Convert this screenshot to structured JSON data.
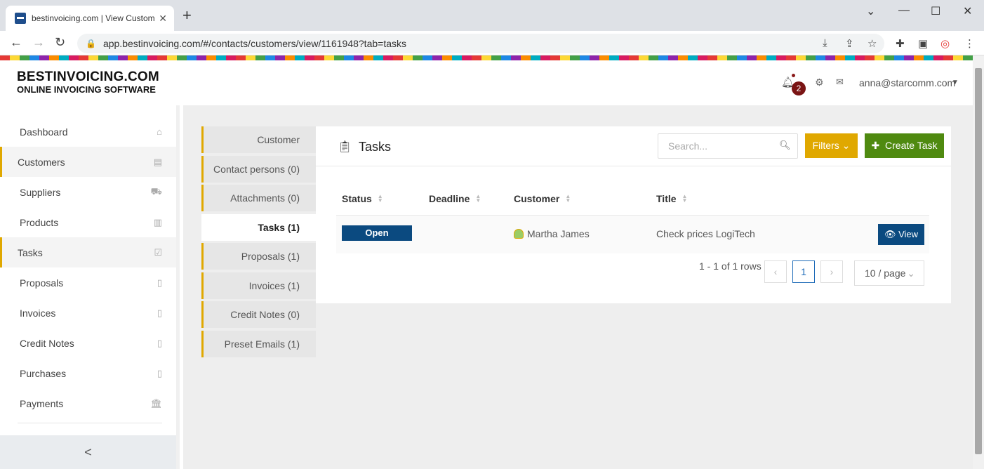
{
  "browser": {
    "tab_title": "bestinvoicing.com | View Custom",
    "tab_close": "✕",
    "new_tab": "+",
    "url": "app.bestinvoicing.com/#/contacts/customers/view/1161948?tab=tasks"
  },
  "header": {
    "logo_line1": "BESTINVOICING.COM",
    "logo_line2": "ONLINE INVOICING SOFTWARE",
    "notification_count": "2",
    "user_email": "anna@starcomm.com"
  },
  "sidebar": {
    "items": [
      {
        "label": "Dashboard",
        "icon": "home-icon"
      },
      {
        "label": "Customers",
        "icon": "address-book-icon"
      },
      {
        "label": "Suppliers",
        "icon": "truck-icon"
      },
      {
        "label": "Products",
        "icon": "barcode-icon"
      },
      {
        "label": "Tasks",
        "icon": "clipboard-check-icon"
      },
      {
        "label": "Proposals",
        "icon": "pdf-file-icon"
      },
      {
        "label": "Invoices",
        "icon": "pdf-file-icon"
      },
      {
        "label": "Credit Notes",
        "icon": "pdf-file-icon"
      },
      {
        "label": "Purchases",
        "icon": "pdf-file-icon"
      },
      {
        "label": "Payments",
        "icon": "bank-icon"
      }
    ],
    "collapse": "<"
  },
  "subnav": {
    "items": [
      "Customer",
      "Contact persons (0)",
      "Attachments (0)",
      "Tasks (1)",
      "Proposals (1)",
      "Invoices (1)",
      "Credit Notes (0)",
      "Preset Emails (1)"
    ]
  },
  "panel": {
    "title": "Tasks",
    "search_placeholder": "Search...",
    "filters_label": "Filters",
    "create_label": "Create Task"
  },
  "table": {
    "columns": [
      "Status",
      "Deadline",
      "Customer",
      "Title"
    ],
    "rows": [
      {
        "status": "Open",
        "deadline": "",
        "customer": "Martha James",
        "title": "Check prices LogiTech",
        "action": "View"
      }
    ]
  },
  "pagination": {
    "summary": "1 - 1 of 1 rows",
    "current_page": "1",
    "page_size": "10 / page"
  },
  "colors": {
    "accent_yellow": "#e0a800",
    "primary_blue": "#0b4a80",
    "create_green": "#4f8a10",
    "badge_red": "#7a1414"
  }
}
